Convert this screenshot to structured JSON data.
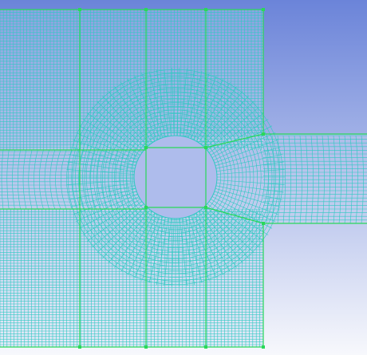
{
  "viewport": {
    "name": "mesh-viewport",
    "background_top_color": "#6b84d9",
    "background_bottom_color": "#f7f8fc",
    "mesh_line_color": "#2fc9c2",
    "block_edge_color": "#29d85a",
    "vertex_color": "#29d85a"
  }
}
